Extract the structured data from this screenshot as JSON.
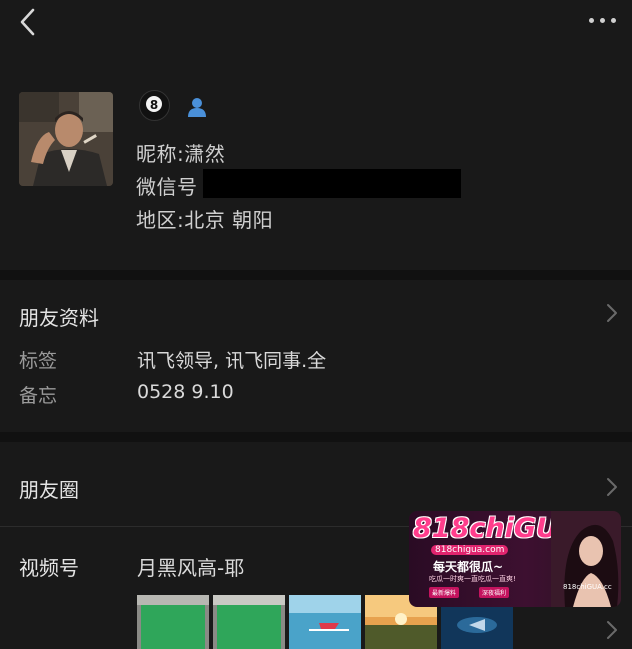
{
  "header": {
    "back_icon": "chevron-left-icon",
    "more_icon": "more-dots-icon"
  },
  "profile": {
    "avatar_icon": "avatar",
    "badge_icon": "billiard-8-ball-icon",
    "gender_icon": "person-icon",
    "nickname_label": "昵称",
    "nickname_sep": ":",
    "nickname_value": "潇然",
    "wechat_label": "微信号",
    "region_label": "地区",
    "region_sep": ":",
    "region_value": "北京 朝阳"
  },
  "friend_info": {
    "title": "朋友资料",
    "rows": [
      {
        "label": "标签",
        "value": "讯飞领导, 讯飞同事.全"
      },
      {
        "label": "备忘",
        "value": "0528    9.10"
      }
    ]
  },
  "moments": {
    "title": "朋友圈"
  },
  "channels": {
    "title": "视频号",
    "value": "月黑风高-耶",
    "thumbnails": [
      "green-screen-thumbnail",
      "green-screen-thumbnail",
      "boat-sea-thumbnail",
      "sunset-field-thumbnail",
      "underwater-thumbnail"
    ]
  },
  "ad_overlay": {
    "logo": "818chiGUA",
    "url": "818chigua.com",
    "slogan": "每天都很瓜~",
    "sub": "吃瓜一时爽一直吃瓜一直爽!",
    "tag1": "最新爆料",
    "tag2": "深夜福利",
    "side": "818chiGUA.cc"
  },
  "colors": {
    "background": "#191919",
    "band": "#111111",
    "text_primary": "#e4e4e4",
    "text_secondary": "#9a9a9a",
    "ad_accent": "#ff3d8c"
  }
}
